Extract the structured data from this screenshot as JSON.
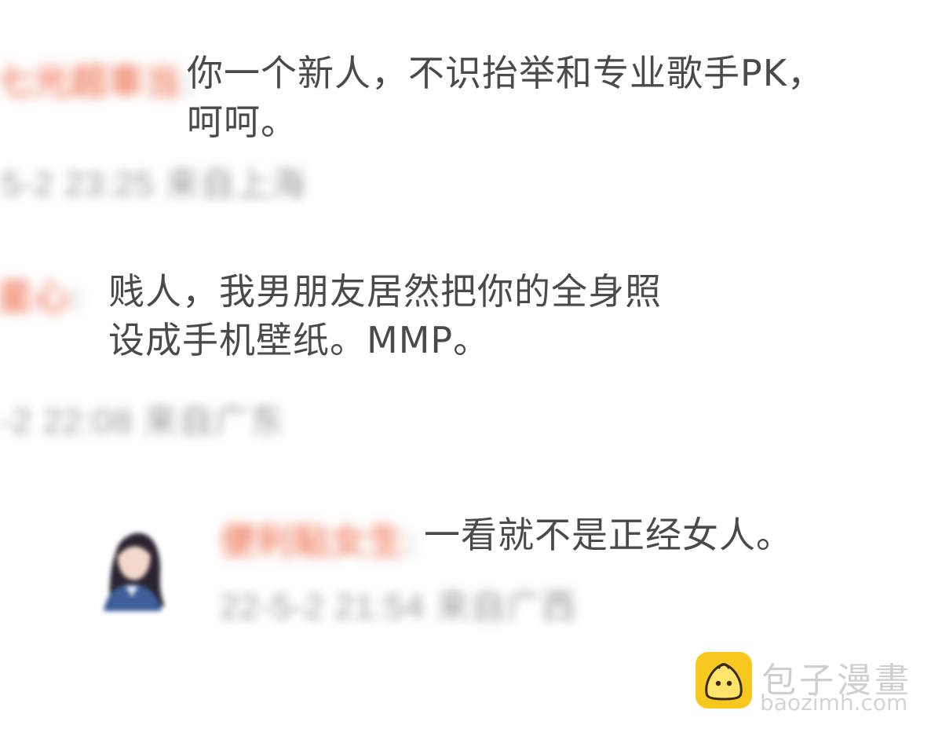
{
  "comments": [
    {
      "username": "七光超車当",
      "separator": ":",
      "text_lines": [
        "你一个新人，不识抬举和专业歌手PK，",
        "呵呵。"
      ],
      "meta": "5-2 23:25 来自上海"
    },
    {
      "username": "星心",
      "separator": ":",
      "text_lines": [
        "贱人，我男朋友居然把你的全身照",
        "设成手机壁纸。MMP。"
      ],
      "meta": "-2 22:08 来自广东"
    }
  ],
  "reply": {
    "avatar_icon": "anime-girl-avatar-icon",
    "username": "便利贴女生",
    "separator": ":",
    "text": "一看就不是正经女人。",
    "meta": "22-5-2 21:54 来自广西"
  },
  "watermark": {
    "logo_icon": "bun-face-icon",
    "brand": "包子漫畫",
    "url": "baozimh.com",
    "logo_color": "#f8c81e"
  },
  "colors": {
    "username": "#f0866a",
    "meta": "#9c9c9c",
    "text": "#4a4a4a"
  }
}
